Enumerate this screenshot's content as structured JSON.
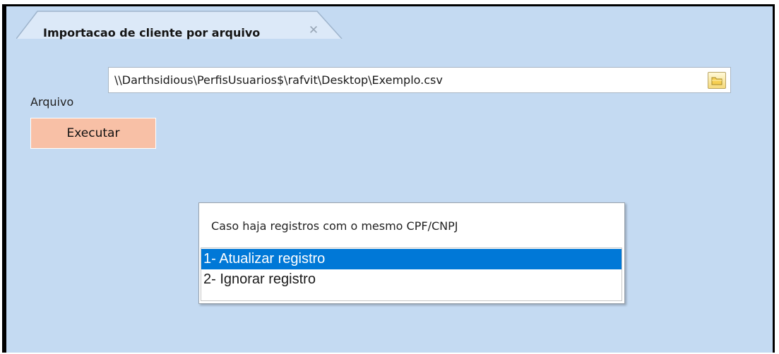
{
  "tab": {
    "title": "Importacao de cliente por arquivo",
    "close_glyph": "✕"
  },
  "file": {
    "label": "Arquivo",
    "value": "\\\\Darthsidious\\PerfisUsuarios$\\rafvit\\Desktop\\Exemplo.csv",
    "browse_icon": "folder-icon"
  },
  "execute_label": "Executar",
  "dialog": {
    "prompt": "Caso haja registros com o mesmo CPF/CNPJ",
    "options": [
      "1- Atualizar registro",
      "2- Ignorar registro"
    ],
    "selected_index": 0
  },
  "colors": {
    "window_bg": "#c4daf2",
    "execute_bg": "#f8c0a6",
    "selection": "#0078d7"
  }
}
